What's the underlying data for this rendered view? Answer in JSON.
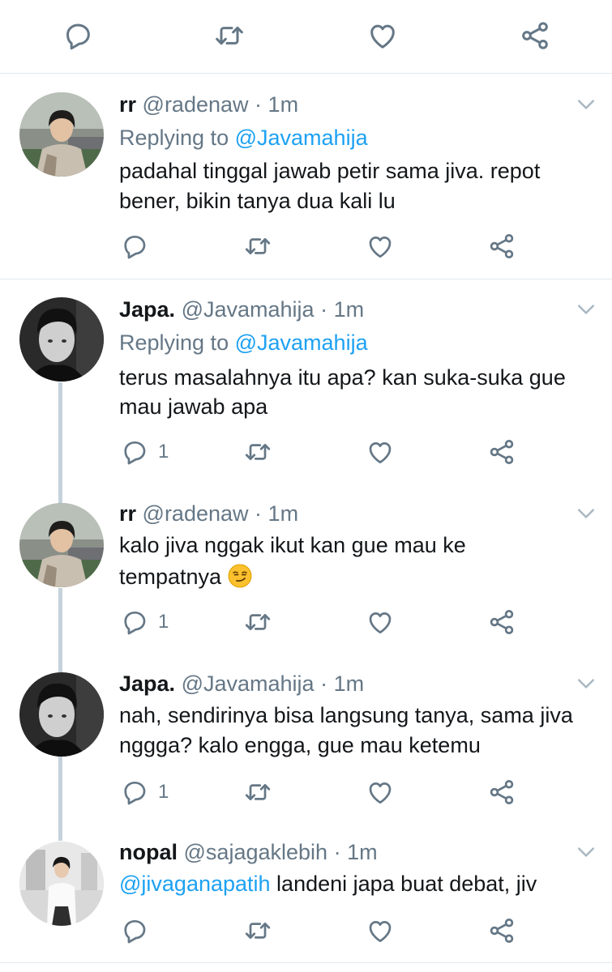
{
  "top_actions": {
    "icons": [
      "reply-icon",
      "retweet-icon",
      "like-icon",
      "share-icon"
    ]
  },
  "tweets": [
    {
      "name": "rr",
      "handle": "@radenaw",
      "separator": "·",
      "time": "1m",
      "replying_label": "Replying to",
      "replying_to": "@Javamahija",
      "lines": [
        "padahal tinggal jawab petir sama jiva. repot",
        "bener, bikin tanya dua kali lu"
      ],
      "reply_count": ""
    },
    {
      "name": "Japa.",
      "handle": "@Javamahija",
      "separator": "·",
      "time": "1m",
      "replying_label": "Replying to",
      "replying_to": "@Javamahija",
      "lines": [
        "terus masalahnya itu apa? kan suka-suka gue",
        "mau jawab apa"
      ],
      "reply_count": "1"
    },
    {
      "name": "rr",
      "handle": "@radenaw",
      "separator": "·",
      "time": "1m",
      "lines": [
        "kalo jiva nggak ikut kan gue mau ke",
        "tempatnya"
      ],
      "emoji": "smirking-face-emoji",
      "reply_count": "1"
    },
    {
      "name": "Japa.",
      "handle": "@Javamahija",
      "separator": "·",
      "time": "1m",
      "lines": [
        "nah, sendirinya bisa langsung tanya, sama jiva",
        "nggga? kalo  engga, gue mau ketemu"
      ],
      "reply_count": "1"
    },
    {
      "name": "nopal",
      "handle": "@sajagaklebih",
      "separator": "·",
      "time": "1m",
      "mention": "@jivaganapatih",
      "line_rest": " landeni japa buat debat, jiv",
      "reply_count": ""
    }
  ],
  "colors": {
    "accent": "#1da1f2",
    "muted": "#657786",
    "text": "#14171a",
    "divider": "#e1e8ed",
    "thread": "#c4d2db"
  }
}
